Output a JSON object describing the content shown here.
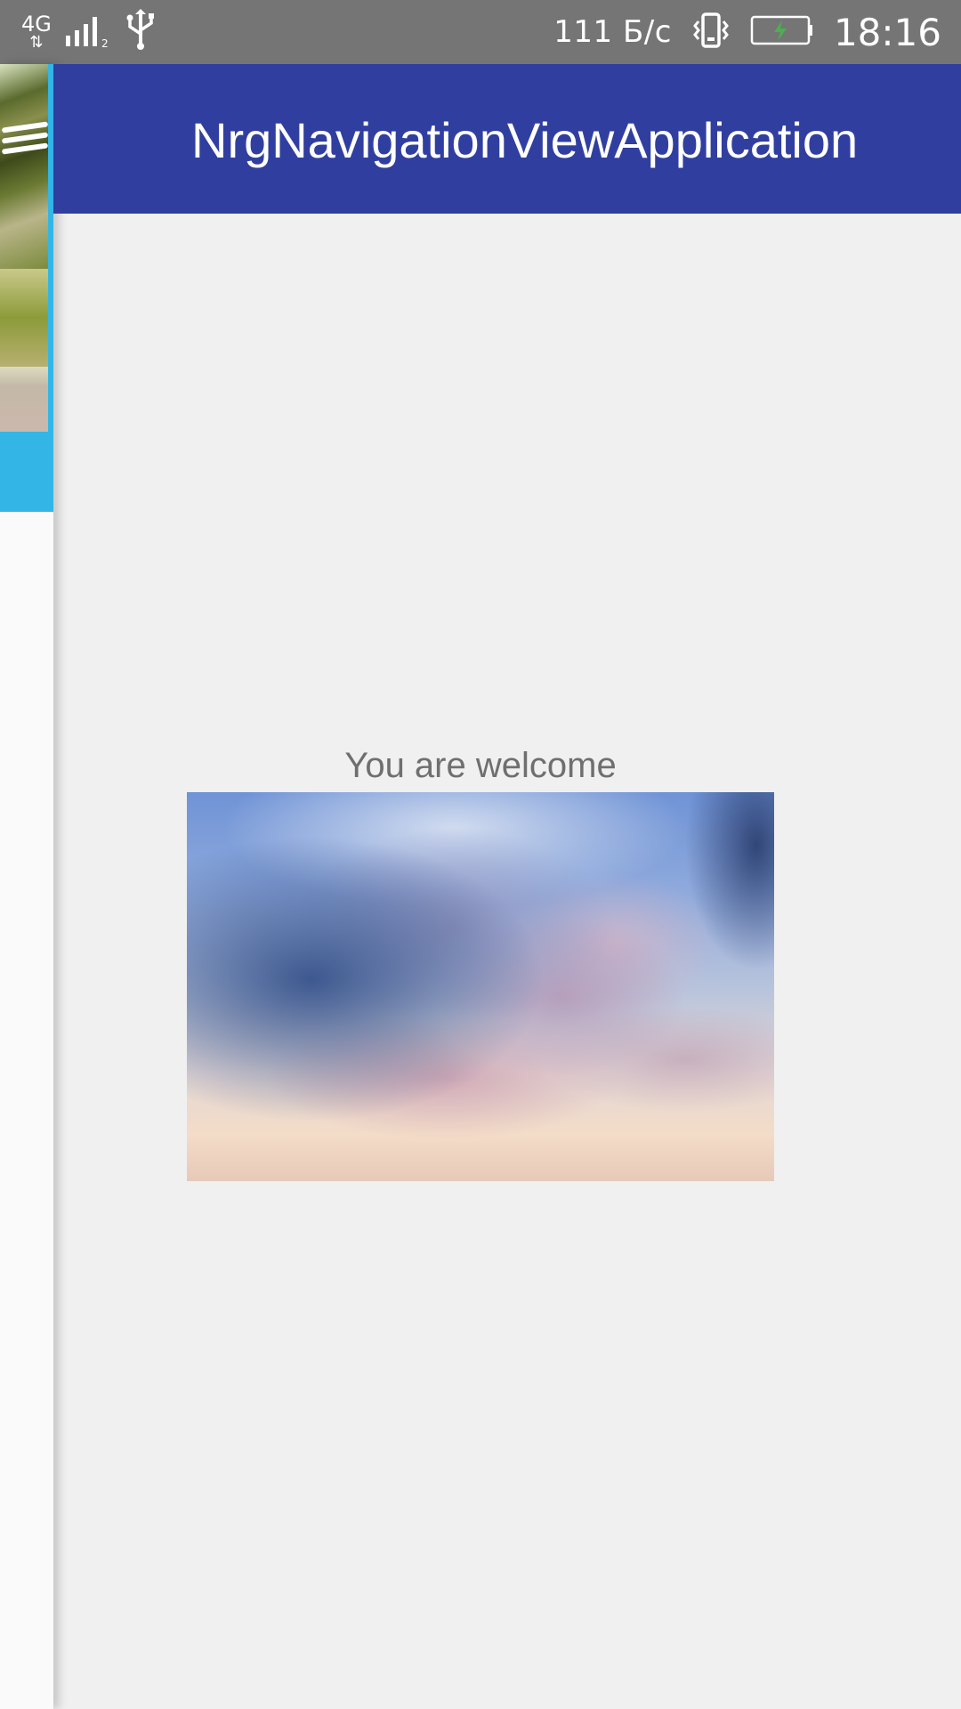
{
  "status_bar": {
    "network_type": "4G",
    "network_arrows": "⇅",
    "signal_icon": "signal-icon",
    "usb_icon": "usb-icon",
    "speed": "111 Б/с",
    "vibrate_icon": "vibrate-icon",
    "battery_icon": "battery-charging-icon",
    "time": "18:16"
  },
  "toolbar": {
    "title": "NrgNavigationViewApplication",
    "menu_icon": "hamburger-menu-icon",
    "color": "#303f9f"
  },
  "drawer": {
    "header_color": "#33b5e5"
  },
  "main": {
    "welcome_text": "You are welcome",
    "image": "sky-with-clouds-image"
  }
}
